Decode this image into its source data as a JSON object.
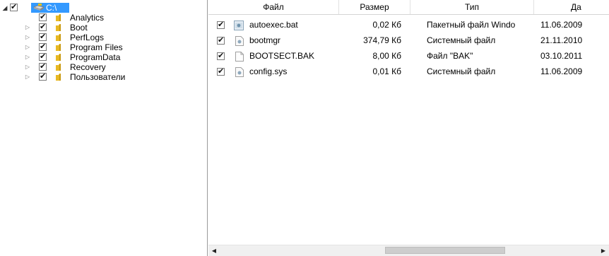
{
  "tree": {
    "root": {
      "label": "C:\\",
      "expanded": true,
      "checked": true,
      "selected": true
    },
    "items": [
      {
        "label": "Analytics",
        "has_children": false,
        "checked": true
      },
      {
        "label": "Boot",
        "has_children": true,
        "checked": true
      },
      {
        "label": "PerfLogs",
        "has_children": true,
        "checked": true
      },
      {
        "label": "Program Files",
        "has_children": true,
        "checked": true
      },
      {
        "label": "ProgramData",
        "has_children": true,
        "checked": true
      },
      {
        "label": "Recovery",
        "has_children": true,
        "checked": true
      },
      {
        "label": "Пользователи",
        "has_children": true,
        "checked": true
      }
    ]
  },
  "file_list": {
    "columns": {
      "file": "Файл",
      "size": "Размер",
      "type": "Тип",
      "date": "Да"
    },
    "rows": [
      {
        "name": "autoexec.bat",
        "size": "0,02 Кб",
        "type": "Пакетный файл Windo",
        "date": "11.06.2009",
        "icon": "batch-file-icon",
        "checked": true
      },
      {
        "name": "bootmgr",
        "size": "374,79 Кб",
        "type": "Системный файл",
        "date": "21.11.2010",
        "icon": "system-file-icon",
        "checked": true
      },
      {
        "name": "BOOTSECT.BAK",
        "size": "8,00 Кб",
        "type": "Файл \"BAK\"",
        "date": "03.10.2011",
        "icon": "blank-file-icon",
        "checked": true
      },
      {
        "name": "config.sys",
        "size": "0,01 Кб",
        "type": "Системный файл",
        "date": "11.06.2009",
        "icon": "system-file-icon",
        "checked": true
      }
    ]
  },
  "colors": {
    "selection": "#3399ff",
    "folder": "#e8b923",
    "divider": "#9a9a9a"
  }
}
